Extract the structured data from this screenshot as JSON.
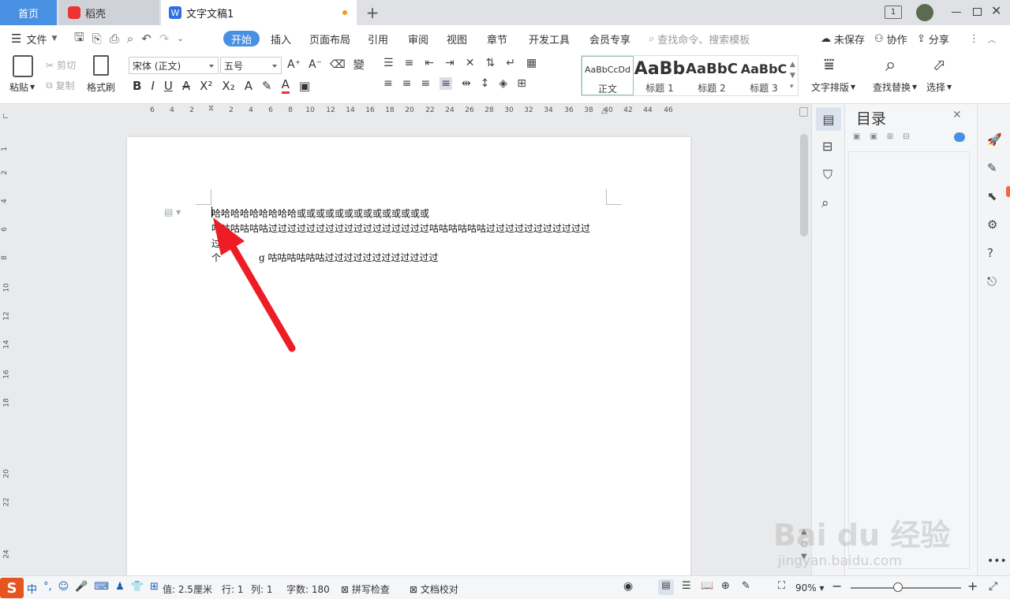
{
  "tabs": {
    "home": "首页",
    "daoke": "稻壳",
    "doc": "文字文稿1",
    "add": "+"
  },
  "menu": {
    "file": "文件",
    "start": "开始",
    "insert": "插入",
    "layout": "页面布局",
    "reference": "引用",
    "review": "审阅",
    "view": "视图",
    "chapter": "章节",
    "devtools": "开发工具",
    "member": "会员专享",
    "search_placeholder": "查找命令、搜索模板",
    "unsaved": "未保存",
    "collab": "协作",
    "share": "分享"
  },
  "ribbon": {
    "paste": "粘贴",
    "cut": "剪切",
    "copy": "复制",
    "format_painter": "格式刷",
    "font_name": "宋体 (正文)",
    "font_size": "五号",
    "style_normal_preview": "AaBbCcDd",
    "style_normal": "正文",
    "style_h1_preview": "AaBb",
    "style_h1": "标题 1",
    "style_h2_preview": "AaBbC",
    "style_h2": "标题 2",
    "style_h3_preview": "AaBbC",
    "style_h3": "标题 3",
    "text_layout": "文字排版",
    "find_replace": "查找替换",
    "select": "选择"
  },
  "ruler_numbers": [
    "6",
    "4",
    "2",
    "2",
    "4",
    "6",
    "8",
    "10",
    "12",
    "14",
    "16",
    "18",
    "20",
    "22",
    "24",
    "26",
    "28",
    "30",
    "32",
    "34",
    "36",
    "38",
    "40",
    "42",
    "44",
    "46"
  ],
  "vruler_numbers": [
    "1",
    "2",
    "4",
    "6",
    "8",
    "10",
    "12",
    "14",
    "16",
    "18",
    "20",
    "22",
    "24"
  ],
  "document": {
    "lines": [
      "哈哈哈哈哈哈哈哈哈或或或或或或或或或或或或或或",
      "咕咕咕咕咕咕过过过过过过过过过过过过过过过过过咕咕咕咕咕咕过过过过过过过过过过过",
      "过",
      "个　　　　g  咕咕咕咕咕咕过过过过过过过过过过过过"
    ]
  },
  "toc": {
    "title": "目录"
  },
  "status": {
    "setting": "值: 2.5厘米",
    "row": "行: 1",
    "col": "列: 1",
    "words": "字数: 180",
    "spellcheck": "拼写检查",
    "doc_check": "文档校对",
    "zoom": "90%",
    "ime_text": "中"
  },
  "watermark": {
    "text": "Bai du 经验",
    "url": "jingyan.baidu.com"
  },
  "colors": {
    "accent": "#4a90e2",
    "arrow": "#ee1c25",
    "dot": "#f29b1d"
  }
}
